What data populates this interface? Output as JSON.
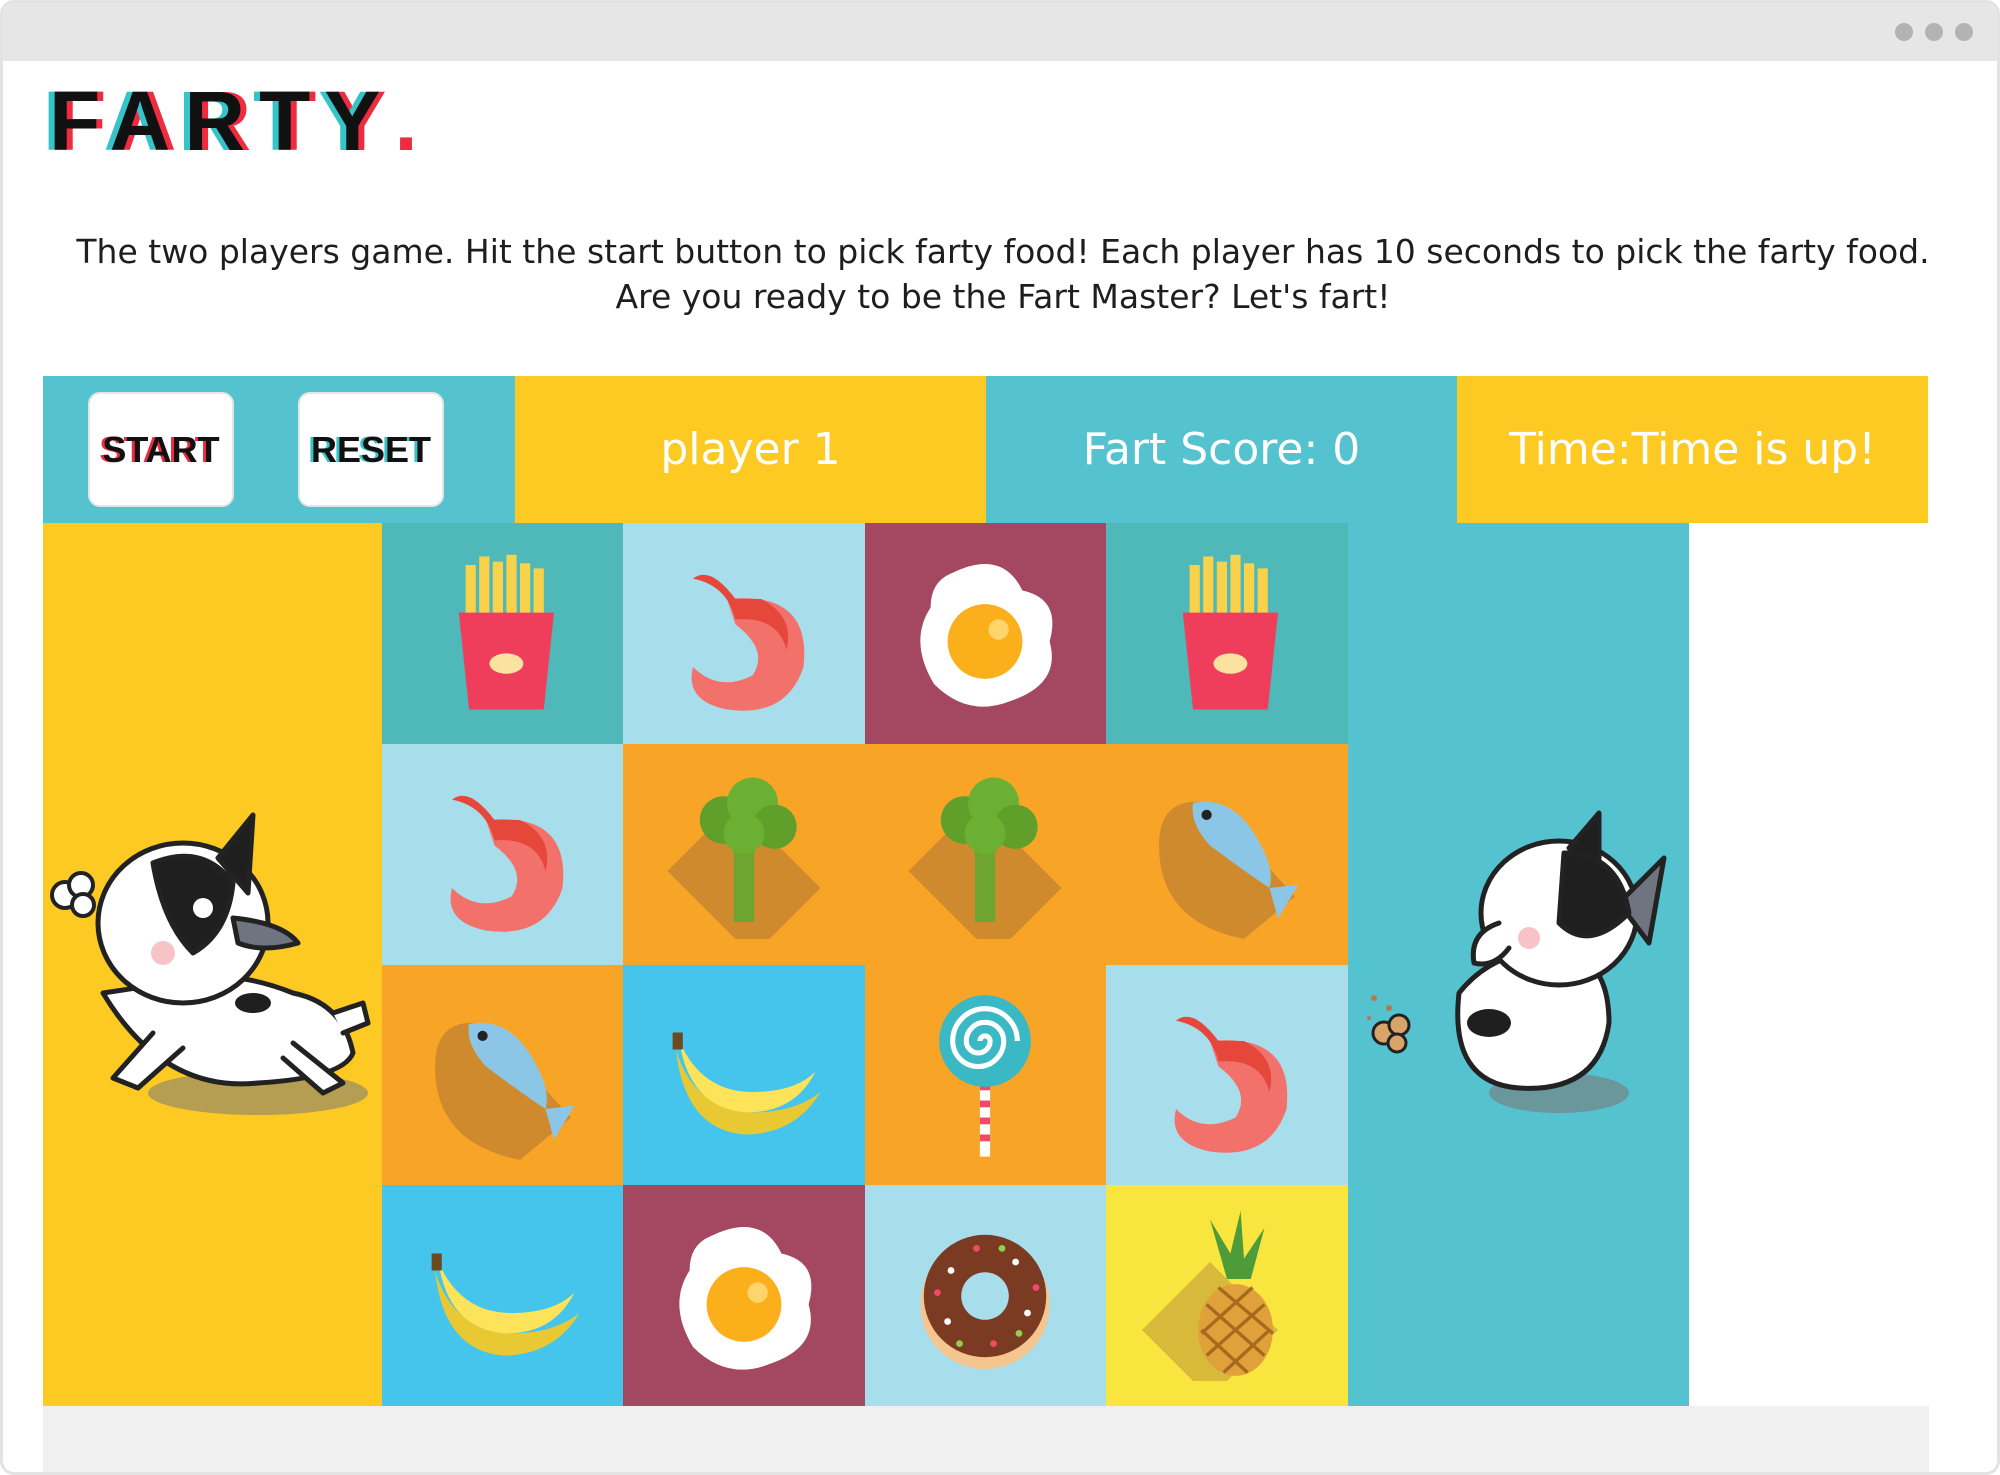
{
  "browser": {
    "menu_icon": "ellipsis-icon"
  },
  "logo": {
    "text": "FARTY",
    "dot": "."
  },
  "description": "The two players game. Hit the start button to pick farty food! Each player has 10 seconds to pick the farty food. Are you ready to be the Fart Master? Let's fart!",
  "controls": {
    "start_label": "START",
    "reset_label": "RESET"
  },
  "status": {
    "player": "player 1",
    "score": "Fart Score: 0",
    "time": "Time:Time is up!"
  },
  "colors": {
    "yellow": "#fcca22",
    "teal": "#54c3cf",
    "teal_dark": "#4fb9ba",
    "light_blue": "#a8deeb",
    "maroon": "#a44760",
    "orange": "#f8a527",
    "sky_blue": "#45c5ec",
    "lemon": "#f8e63f",
    "logo_red": "#ef2c3f",
    "logo_cyan": "#36c4c9"
  },
  "grid": {
    "columns": 5,
    "rows": 4,
    "cells": [
      {
        "food": "fries",
        "bg": "#4fb9ba"
      },
      {
        "food": "shrimp",
        "bg": "#a8deeb"
      },
      {
        "food": "egg",
        "bg": "#a44760"
      },
      {
        "food": "fries",
        "bg": "#4fb9ba"
      },
      {
        "food": "",
        "bg": "#54c3cf"
      },
      {
        "food": "shrimp",
        "bg": "#a8deeb"
      },
      {
        "food": "broccoli",
        "bg": "#f8a527"
      },
      {
        "food": "broccoli",
        "bg": "#f8a527"
      },
      {
        "food": "fish",
        "bg": "#f8a527"
      },
      {
        "food": "",
        "bg": "#54c3cf"
      },
      {
        "food": "fish",
        "bg": "#f8a527"
      },
      {
        "food": "banana",
        "bg": "#45c5ec"
      },
      {
        "food": "lollipop",
        "bg": "#f8a527"
      },
      {
        "food": "shrimp",
        "bg": "#a8deeb"
      },
      {
        "food": "",
        "bg": "#54c3cf"
      },
      {
        "food": "banana",
        "bg": "#45c5ec"
      },
      {
        "food": "egg",
        "bg": "#a44760"
      },
      {
        "food": "donut",
        "bg": "#a8deeb"
      },
      {
        "food": "pineapple",
        "bg": "#f8e63f"
      },
      {
        "food": "",
        "bg": "#54c3cf"
      }
    ]
  },
  "characters": {
    "left": "french-bulldog-farting-icon",
    "right": "french-bulldog-farting-icon"
  }
}
